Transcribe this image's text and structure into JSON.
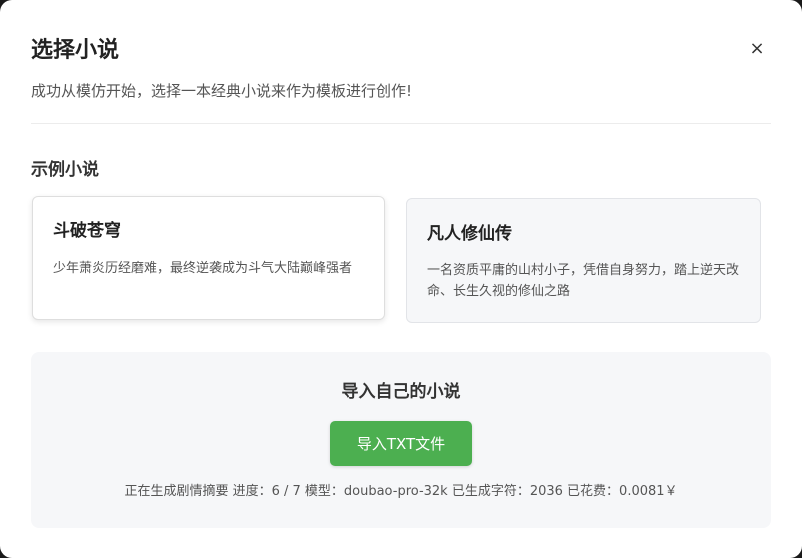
{
  "dialog": {
    "title": "选择小说",
    "close_label": "×",
    "subtitle": "成功从模仿开始，选择一本经典小说来作为模板进行创作!"
  },
  "examples": {
    "heading": "示例小说",
    "cards": [
      {
        "title": "斗破苍穹",
        "description": "少年萧炎历经磨难，最终逆袭成为斗气大陆巅峰强者",
        "selected": true
      },
      {
        "title": "凡人修仙传",
        "description": "一名资质平庸的山村小子，凭借自身努力，踏上逆天改命、长生久视的修仙之路",
        "selected": false
      }
    ]
  },
  "import": {
    "heading": "导入自己的小说",
    "button_label": "导入TXT文件",
    "status_text": "正在生成剧情摘要 进度：6 / 7 模型：doubao-pro-32k 已生成字符：2036 已花费：0.0081￥"
  },
  "colors": {
    "accent": "#4caf50",
    "panel_bg": "#f6f7f9"
  }
}
